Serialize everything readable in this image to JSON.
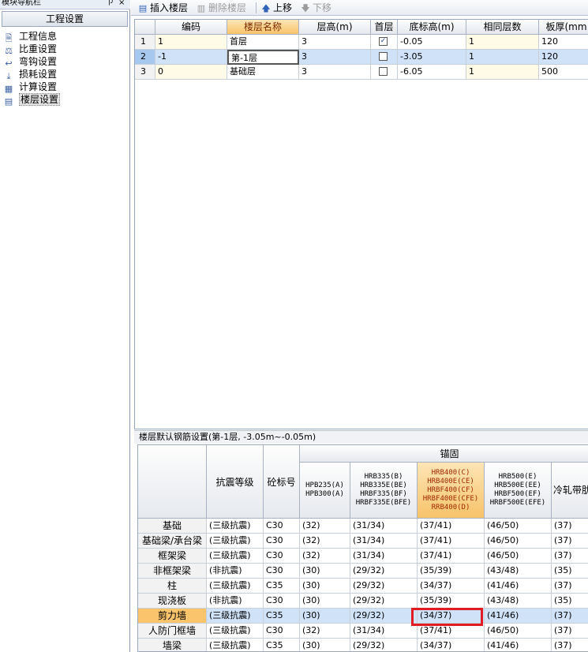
{
  "left_panel": {
    "title": "模块导航栏",
    "pin_glyph": "ㄗ",
    "close_glyph": "×",
    "header": "工程设置",
    "items": [
      {
        "label": "工程信息",
        "icon": "info-doc-icon"
      },
      {
        "label": "比重设置",
        "icon": "ratio-icon"
      },
      {
        "label": "弯钩设置",
        "icon": "hook-icon"
      },
      {
        "label": "损耗设置",
        "icon": "loss-icon"
      },
      {
        "label": "计算设置",
        "icon": "calc-icon"
      },
      {
        "label": "楼层设置",
        "icon": "floor-icon",
        "selected": true
      }
    ]
  },
  "toolbar": {
    "insert_floor": "插入楼层",
    "delete_floor": "删除楼层",
    "move_up": "上移",
    "move_down": "下移"
  },
  "floor_grid": {
    "columns": [
      "编码",
      "楼层名称",
      "层高(m)",
      "首层",
      "底标高(m)",
      "相同层数",
      "板厚(mm"
    ],
    "rows": [
      {
        "num": "1",
        "code": "1",
        "name": "首层",
        "height": "3",
        "first": true,
        "bottom": "-0.05",
        "same": "1",
        "thick": "120"
      },
      {
        "num": "2",
        "code": "-1",
        "name": "第-1层",
        "height": "3",
        "first": false,
        "bottom": "-3.05",
        "same": "1",
        "thick": "120"
      },
      {
        "num": "3",
        "code": "0",
        "name": "基础层",
        "height": "3",
        "first": false,
        "bottom": "-6.05",
        "same": "1",
        "thick": "500"
      }
    ],
    "check_glyph": "✓"
  },
  "lower": {
    "title": "楼层默认钢筋设置(第-1层, -3.05m~-0.05m)",
    "group_header": "锚固",
    "col_seismic": "抗震等级",
    "col_concrete": "砼标号",
    "grades": [
      [
        "HPB235(A)",
        "HPB300(A)"
      ],
      [
        "HRB335(B)",
        "HRB335E(BE)",
        "HRBF335(BF)",
        "HRBF335E(BFE)"
      ],
      [
        "HRB400(C)",
        "HRB400E(CE)",
        "HRBF400(CF)",
        "HRBF400E(CFE)",
        "RRB400(D)"
      ],
      [
        "HRB500(E)",
        "HRB500E(EE)",
        "HRBF500(EF)",
        "HRBF500E(EFE)"
      ],
      [
        "冷轧带肋"
      ]
    ],
    "rows": [
      {
        "name": "基础",
        "seismic": "(三级抗震)",
        "concrete": "C30",
        "v": [
          "(32)",
          "(31/34)",
          "(37/41)",
          "(46/50)",
          "(37)"
        ]
      },
      {
        "name": "基础梁/承台梁",
        "seismic": "(三级抗震)",
        "concrete": "C30",
        "v": [
          "(32)",
          "(31/34)",
          "(37/41)",
          "(46/50)",
          "(37)"
        ]
      },
      {
        "name": "框架梁",
        "seismic": "(三级抗震)",
        "concrete": "C30",
        "v": [
          "(32)",
          "(31/34)",
          "(37/41)",
          "(46/50)",
          "(37)"
        ]
      },
      {
        "name": "非框架梁",
        "seismic": "(非抗震)",
        "concrete": "C30",
        "v": [
          "(30)",
          "(29/32)",
          "(35/39)",
          "(43/48)",
          "(35)"
        ]
      },
      {
        "name": "柱",
        "seismic": "(三级抗震)",
        "concrete": "C35",
        "v": [
          "(30)",
          "(29/32)",
          "(34/37)",
          "(41/46)",
          "(37)"
        ]
      },
      {
        "name": "现浇板",
        "seismic": "(非抗震)",
        "concrete": "C30",
        "v": [
          "(30)",
          "(29/32)",
          "(35/39)",
          "(43/48)",
          "(35)"
        ]
      },
      {
        "name": "剪力墙",
        "seismic": "(三级抗震)",
        "concrete": "C35",
        "v": [
          "(30)",
          "(29/32)",
          "(34/37)",
          "(41/46)",
          "(37)"
        ],
        "selected": true
      },
      {
        "name": "人防门框墙",
        "seismic": "(三级抗震)",
        "concrete": "C30",
        "v": [
          "(32)",
          "(31/34)",
          "(37/41)",
          "(46/50)",
          "(37)"
        ]
      },
      {
        "name": "墙梁",
        "seismic": "(三级抗震)",
        "concrete": "C35",
        "v": [
          "(30)",
          "(29/32)",
          "(34/37)",
          "(41/46)",
          "(37)"
        ]
      }
    ]
  },
  "colors": {
    "selection_blue": "#cfe2f8",
    "header_orange": "#f9c46c",
    "highlight_red": "#e01b24"
  }
}
